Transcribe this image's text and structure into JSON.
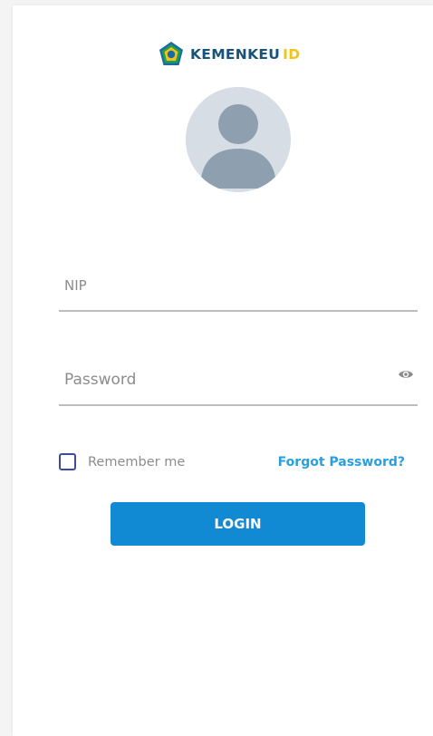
{
  "brand": {
    "name": "KEMENKEU",
    "suffix": "ID",
    "icon": "kemenkeu-emblem-icon"
  },
  "avatar": {
    "icon": "user-avatar-icon"
  },
  "form": {
    "nip": {
      "placeholder": "NIP",
      "value": ""
    },
    "password": {
      "placeholder": "Password",
      "value": "",
      "toggle_icon": "eye-icon"
    },
    "remember_label": "Remember me",
    "remember_checked": false,
    "forgot_label": "Forgot Password?",
    "login_label": "LOGIN"
  },
  "colors": {
    "primary_button": "#128ad3",
    "link": "#2a9fe0",
    "brand_text": "#17537a",
    "brand_accent": "#f3c417",
    "checkbox_border": "#3d4aa0"
  }
}
